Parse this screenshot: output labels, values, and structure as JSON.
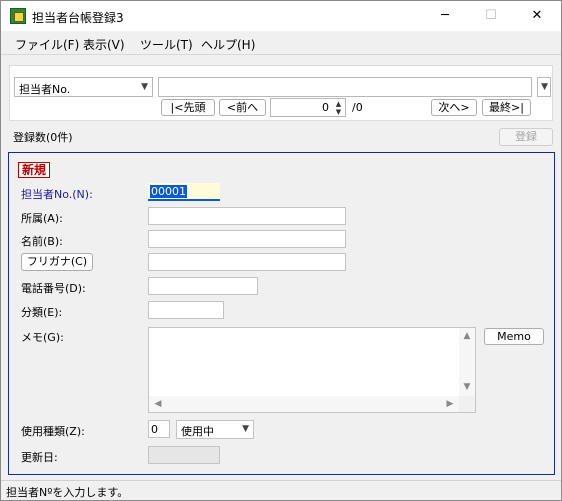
{
  "window": {
    "title": "担当者台帳登録3",
    "minimize_glyph": "─",
    "maximize_glyph": "☐",
    "close_glyph": "✕"
  },
  "menu": [
    {
      "label": "ファイル(F)"
    },
    {
      "label": "表示(V)"
    },
    {
      "label": "ツール(T)"
    },
    {
      "label": "ヘルプ(H)"
    }
  ],
  "search": {
    "key_select": "担当者No.",
    "keyword_value": "",
    "first_button": "|<先頭",
    "prev_button": "<前へ",
    "record_index": "0",
    "record_total": "/0",
    "next_button": "次へ>",
    "last_button": "最終>|"
  },
  "record_count": "登録数(0件)",
  "register_button": "登録",
  "form": {
    "mode_badge": "新規",
    "staff_no_label": "担当者No.(N):",
    "staff_no_value": "00001",
    "affiliation_label": "所属(A):",
    "affiliation_value": "",
    "name_label": "名前(B):",
    "name_value": "",
    "furigana_button": "フリガナ(C)",
    "furigana_value": "",
    "phone_label": "電話番号(D):",
    "phone_value": "",
    "category_label": "分類(E):",
    "category_value": "",
    "memo_label": "メモ(G):",
    "memo_value": "",
    "memo_button": "Memo",
    "usage_label": "使用種類(Z):",
    "usage_code": "0",
    "usage_select": "使用中",
    "updated_label": "更新日:",
    "updated_value": ""
  },
  "status_bar": "担当者Nºを入力します。",
  "colors": {
    "form_border": "#1c2a8a",
    "badge_red": "#c00000",
    "selection_blue": "#0a5ad6",
    "label_blue": "#1a1aa6"
  }
}
